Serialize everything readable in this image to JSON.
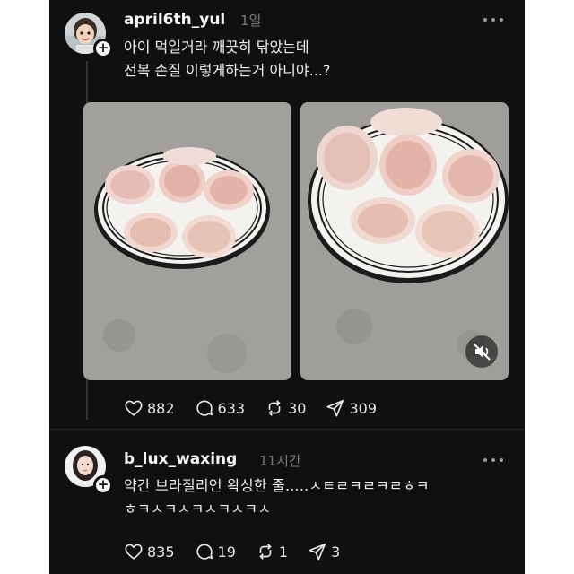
{
  "posts": [
    {
      "username": "april6th_yul",
      "time": "1일",
      "text_lines": [
        "아이 먹일거라 깨끗히 닦았는데",
        "전복 손질 이렇게하는거 아니야...?"
      ],
      "media": [
        {
          "icon": "none"
        },
        {
          "icon": "muted-speaker-icon"
        }
      ],
      "actions": {
        "likes": "882",
        "comments": "633",
        "reposts": "30",
        "shares": "309"
      }
    },
    {
      "username": "b_lux_waxing",
      "time": "11시간",
      "text_lines": [
        "약간 브라질리언 왁싱한 줄.....ㅅㅌㄹㅋㄹㅋㄹㅎㅋ",
        "ㅎㅋㅅㅋㅅㅋㅅㅋㅅㅋㅅ"
      ],
      "actions": {
        "likes": "835",
        "comments": "19",
        "reposts": "1",
        "shares": "3"
      }
    }
  ],
  "colors": {
    "background": "#101010",
    "text": "#f3f3f3",
    "muted": "#7a7a7a"
  }
}
